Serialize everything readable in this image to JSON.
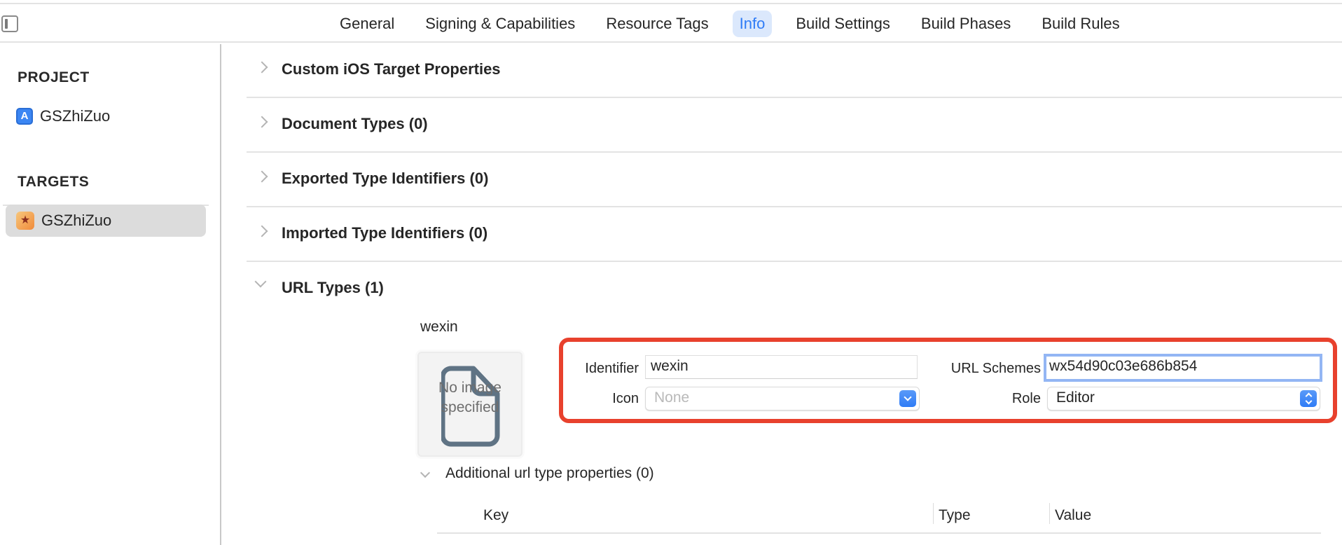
{
  "toolbar": {
    "sidebar_toggle_icon": "sidebar-left-icon",
    "tabs": [
      {
        "label": "General",
        "active": false
      },
      {
        "label": "Signing & Capabilities",
        "active": false
      },
      {
        "label": "Resource Tags",
        "active": false
      },
      {
        "label": "Info",
        "active": true
      },
      {
        "label": "Build Settings",
        "active": false
      },
      {
        "label": "Build Phases",
        "active": false
      },
      {
        "label": "Build Rules",
        "active": false
      }
    ]
  },
  "sidebar": {
    "project_heading": "PROJECT",
    "project_item": {
      "label": "GSZhiZuo",
      "icon": "xcode-project-icon"
    },
    "targets_heading": "TARGETS",
    "target_item": {
      "label": "GSZhiZuo",
      "icon": "app-target-icon",
      "selected": true
    }
  },
  "sections": [
    {
      "title": "Custom iOS Target Properties",
      "expanded": false
    },
    {
      "title": "Document Types (0)",
      "expanded": false
    },
    {
      "title": "Exported Type Identifiers (0)",
      "expanded": false
    },
    {
      "title": "Imported Type Identifiers (0)",
      "expanded": false
    },
    {
      "title": "URL Types (1)",
      "expanded": true
    }
  ],
  "url_type": {
    "name": "wexin",
    "image_placeholder": "No image specified",
    "identifier_label": "Identifier",
    "identifier_value": "wexin",
    "icon_label": "Icon",
    "icon_value": "None",
    "url_schemes_label": "URL Schemes",
    "url_schemes_value": "wx54d90c03e686b854",
    "role_label": "Role",
    "role_value": "Editor",
    "highlight_color": "#e8412d"
  },
  "additional_properties": {
    "title": "Additional url type properties (0)",
    "columns": [
      "Key",
      "Type",
      "Value"
    ]
  },
  "colors": {
    "accent": "#2f7cf6",
    "active_tab_bg": "#dbe8fc",
    "selected_row_bg": "#dcdcdc"
  }
}
